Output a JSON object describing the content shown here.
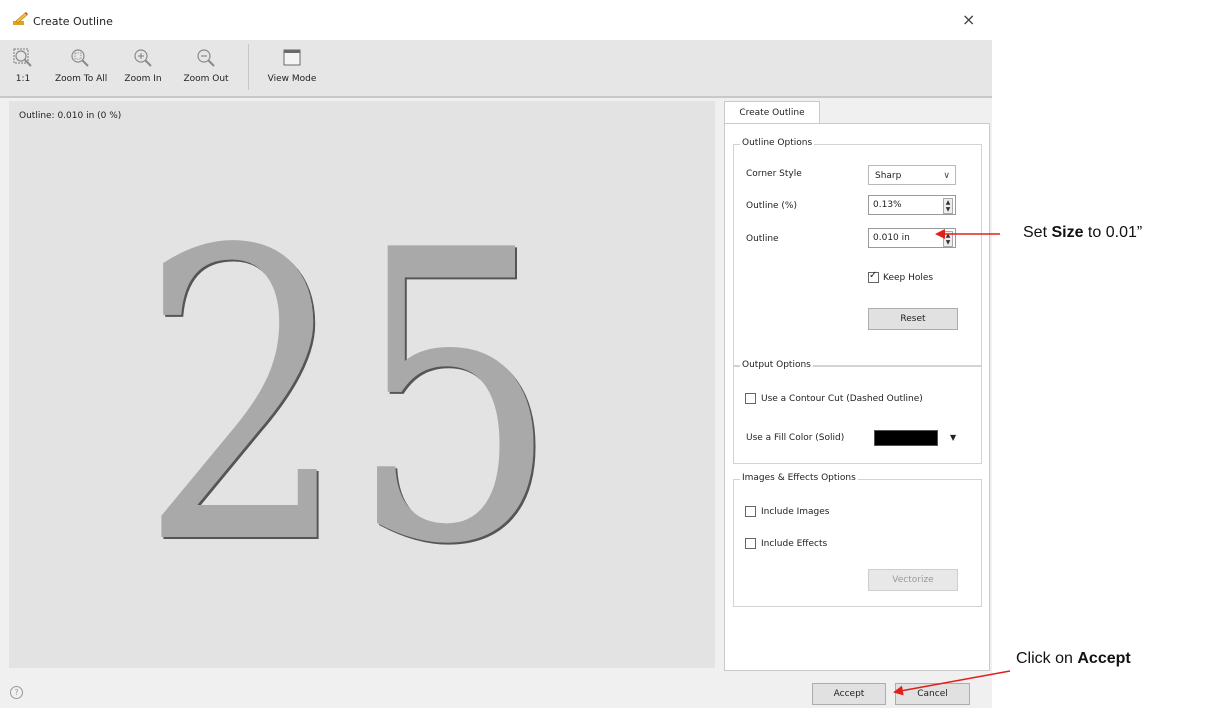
{
  "window": {
    "title": "Create Outline",
    "close_glyph": "×"
  },
  "toolbar": {
    "buttons": [
      {
        "label": "1:1",
        "icon": "actual-size-icon"
      },
      {
        "label": "Zoom To All",
        "icon": "zoom-to-all-icon"
      },
      {
        "label": "Zoom In",
        "icon": "zoom-in-icon"
      },
      {
        "label": "Zoom Out",
        "icon": "zoom-out-icon"
      },
      {
        "label": "View Mode",
        "icon": "view-mode-icon"
      }
    ]
  },
  "canvas": {
    "status": "Outline: 0.010 in (0 %)",
    "glyph_text": "25",
    "glyph_color": "#a9a9a9"
  },
  "panel": {
    "tab_label": "Create Outline",
    "outline_options": {
      "title": "Outline Options",
      "corner_style_label": "Corner Style",
      "corner_style_value": "Sharp",
      "outline_pct_label": "Outline (%)",
      "outline_pct_value": "0.13%",
      "outline_label": "Outline",
      "outline_value": "0.010 in",
      "keep_holes_label": "Keep Holes",
      "keep_holes_checked": true,
      "reset_label": "Reset"
    },
    "output_options": {
      "title": "Output Options",
      "contour_cut_label": "Use a Contour Cut (Dashed Outline)",
      "contour_cut_checked": false,
      "fill_color_label": "Use a Fill Color (Solid)",
      "fill_color": "#000000"
    },
    "images_effects": {
      "title": "Images & Effects Options",
      "include_images_label": "Include Images",
      "include_images_checked": false,
      "include_effects_label": "Include Effects",
      "include_effects_checked": false,
      "vectorize_label": "Vectorize"
    }
  },
  "footer": {
    "help_glyph": "?",
    "accept_label": "Accept",
    "cancel_label": "Cancel"
  },
  "annotations": {
    "size_prefix": "Set ",
    "size_bold": "Size",
    "size_suffix": " to 0.01”",
    "accept_prefix": "Click on ",
    "accept_bold": "Accept",
    "arrow_color": "#e0201b"
  }
}
